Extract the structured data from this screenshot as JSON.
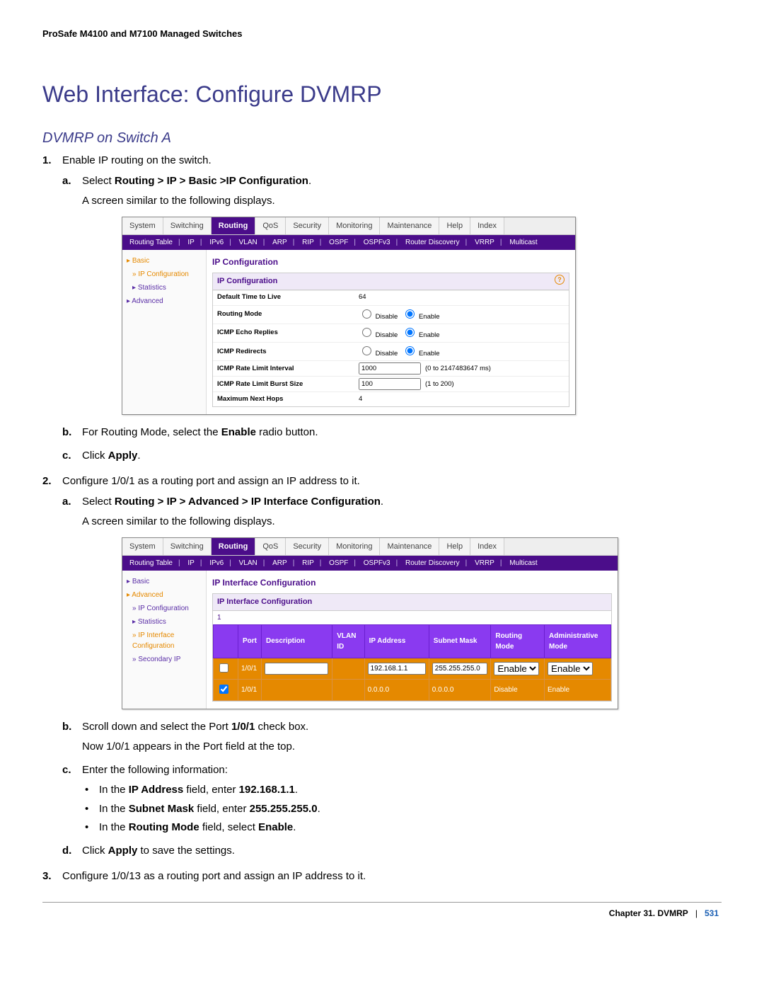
{
  "header": {
    "doc_title": "ProSafe M4100 and M7100 Managed Switches"
  },
  "title": "Web Interface: Configure DVMRP",
  "subsection": "DVMRP on Switch A",
  "steps": {
    "s1": {
      "text": "Enable IP routing on the switch.",
      "a_prefix": "Select ",
      "a_bold": "Routing > IP > Basic >IP Configuration",
      "a_suffix": ".",
      "a_note": "A screen similar to the following displays.",
      "b_prefix": "For Routing Mode, select the ",
      "b_bold": "Enable",
      "b_suffix": " radio button.",
      "c_prefix": "Click ",
      "c_bold": "Apply",
      "c_suffix": "."
    },
    "s2": {
      "text": "Configure 1/0/1 as a routing port and assign an IP address to it.",
      "a_prefix": "Select ",
      "a_bold": "Routing > IP > Advanced > IP Interface Configuration",
      "a_suffix": ".",
      "a_note": "A screen similar to the following displays.",
      "b_prefix": "Scroll down and select the Port ",
      "b_bold": "1/0/1",
      "b_suffix": " check box.",
      "b_note": "Now 1/0/1 appears in the Port field at the top.",
      "c_text": "Enter the following information:",
      "bullets": {
        "ip_label": "IP Address",
        "ip_value": "192.168.1.1",
        "mask_label": "Subnet Mask",
        "mask_value": "255.255.255.0",
        "mode_label": "Routing Mode",
        "mode_value": "Enable"
      },
      "d_prefix": "Click ",
      "d_bold": "Apply",
      "d_suffix": " to save the settings."
    },
    "s3": {
      "text": "Configure 1/0/13 as a routing port and assign an IP address to it."
    }
  },
  "screenshot1": {
    "tabs": [
      "System",
      "Switching",
      "Routing",
      "QoS",
      "Security",
      "Monitoring",
      "Maintenance",
      "Help",
      "Index"
    ],
    "active_tab": "Routing",
    "subtabs": [
      "Routing Table",
      "IP",
      "IPv6",
      "VLAN",
      "ARP",
      "RIP",
      "OSPF",
      "OSPFv3",
      "Router Discovery",
      "VRRP",
      "Multicast"
    ],
    "sidenav": [
      "Basic",
      "IP Configuration",
      "Statistics",
      "Advanced"
    ],
    "panel_title": "IP Configuration",
    "box_header": "IP Configuration",
    "rows": {
      "ttl_label": "Default Time to Live",
      "ttl_value": "64",
      "routing_mode_label": "Routing Mode",
      "echo_label": "ICMP Echo Replies",
      "redirects_label": "ICMP Redirects",
      "rate_interval_label": "ICMP Rate Limit Interval",
      "rate_interval_value": "1000",
      "rate_interval_hint": "(0 to 2147483647 ms)",
      "rate_burst_label": "ICMP Rate Limit Burst Size",
      "rate_burst_value": "100",
      "rate_burst_hint": "(1 to 200)",
      "max_hops_label": "Maximum Next Hops",
      "max_hops_value": "4",
      "disable": "Disable",
      "enable": "Enable"
    }
  },
  "screenshot2": {
    "tabs": [
      "System",
      "Switching",
      "Routing",
      "QoS",
      "Security",
      "Monitoring",
      "Maintenance",
      "Help",
      "Index"
    ],
    "active_tab": "Routing",
    "subtabs": [
      "Routing Table",
      "IP",
      "IPv6",
      "VLAN",
      "ARP",
      "RIP",
      "OSPF",
      "OSPFv3",
      "Router Discovery",
      "VRRP",
      "Multicast"
    ],
    "sidenav": [
      "Basic",
      "Advanced",
      "IP Configuration",
      "Statistics",
      "IP Interface Configuration",
      "Secondary IP"
    ],
    "panel_title": "IP Interface Configuration",
    "box_header": "IP Interface Configuration",
    "columns": [
      "",
      "Port",
      "Description",
      "VLAN ID",
      "IP Address",
      "Subnet Mask",
      "Routing Mode",
      "Administrative Mode"
    ],
    "edit_row": {
      "port": "1/0/1",
      "ip": "192.168.1.1",
      "mask": "255.255.255.0",
      "rmode": "Enable",
      "amode": "Enable"
    },
    "data_row": {
      "port": "1/0/1",
      "ip": "0.0.0.0",
      "mask": "0.0.0.0",
      "rmode": "Disable",
      "amode": "Enable"
    },
    "one": "1"
  },
  "footer": {
    "chapter": "Chapter 31.  DVMRP",
    "sep": "|",
    "page": "531"
  }
}
